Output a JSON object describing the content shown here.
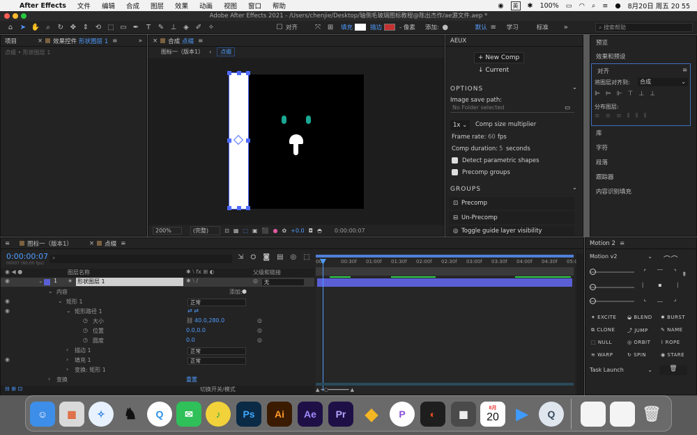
{
  "menubar": {
    "app": "After Effects",
    "items": [
      "文件",
      "编辑",
      "合成",
      "图层",
      "效果",
      "动画",
      "视图",
      "窗口",
      "帮助"
    ],
    "battery": "100%",
    "ime": "英",
    "datetime": "8月20日 周五 20 55"
  },
  "titlebar": {
    "title": "Adobe After Effects 2021 - /Users/chenjie/Desktop/轴侧毛玻璃图标教程@陈出杰作/ae源文件.aep *"
  },
  "toolbar": {
    "align_label": "对齐",
    "fill_label": "填充",
    "stroke_label": "描边",
    "px_label": "- 像素",
    "add_label": "添加:",
    "workspaces": [
      "默认",
      "学习",
      "标准"
    ],
    "search_placeholder": "搜索帮助"
  },
  "project_panel": {
    "tab1": "项目",
    "tab2": "效果控件",
    "tab2_hl": "形状图层 1",
    "sub": "点缀 • 形状图层 1"
  },
  "comp_panel": {
    "tab_label": "合成",
    "tab_hl": "点缀",
    "crumb1": "图标一（版本1）",
    "crumb2": "点缀",
    "zoom": "200%",
    "quality": "(完整)",
    "exposure": "+0.0",
    "timecode": "0:00:00:07"
  },
  "aeux": {
    "title": "AEUX",
    "new_comp": "New Comp",
    "current": "Current",
    "options_header": "OPTIONS",
    "image_save_path": "Image save path:",
    "no_folder": "No Folder selected",
    "multiplier": "1x",
    "multiplier_label": "Comp size multiplier",
    "frame_rate_label": "Frame rate:",
    "frame_rate": "60",
    "fps": "fps",
    "duration_label": "Comp duration:",
    "duration": "5",
    "seconds": "seconds",
    "detect_shapes": "Detect parametric shapes",
    "precomp_groups": "Precomp groups",
    "groups_header": "GROUPS",
    "precomp": "Precomp",
    "unprecomp": "Un-Precomp",
    "toggle_guide": "Toggle guide layer visibility"
  },
  "right_panels": {
    "preview": "预览",
    "effects_presets": "效果和预设",
    "align": "对齐",
    "align_to": "将图层对齐到:",
    "align_to_value": "合成",
    "distribute": "分布图层:",
    "library": "库",
    "character": "字符",
    "paragraph": "段落",
    "tracker": "跟踪器",
    "content_aware": "内容识别填充"
  },
  "timeline": {
    "tab1": "图标一（版本1）",
    "tab2": "点缀",
    "timecode": "0:00:00:07",
    "frames_info": "00007 (60.00 fps)",
    "col_layer_name": "图层名称",
    "col_parent": "父级和链接",
    "layer_num": "1",
    "layer_name": "形状图层 1",
    "parent_value": "无",
    "contents": "内容",
    "add": "添加:",
    "rect1": "矩形 1",
    "rect_path": "矩形路径 1",
    "size": "大小",
    "size_val": "40.0,280.0",
    "position": "位置",
    "position_val": "0.0,0.0",
    "roundness": "圆度",
    "roundness_val": "0.0",
    "stroke1": "描边 1",
    "fill1": "填充 1",
    "transform_rect": "变换: 矩形 1",
    "transform": "变换",
    "reset": "重置",
    "blend_normal": "正常",
    "toggle_modes": "切换开关/模式",
    "ruler": [
      "00f",
      "00:30f",
      "01:00f",
      "01:30f",
      "02:00f",
      "02:30f",
      "03:00f",
      "03:30f",
      "04:00f",
      "04:30f",
      "05:0"
    ]
  },
  "motion": {
    "title": "Motion 2",
    "version": "Motion v2",
    "buttons": [
      "EXCITE",
      "BLEND",
      "BURST",
      "CLONE",
      "JUMP",
      "NAME",
      "NULL",
      "ORBIT",
      "ROPE",
      "WARP",
      "SPIN",
      "STARE"
    ],
    "task": "Task Launch"
  },
  "dock": {
    "apps": [
      "Finder",
      "Launchpad",
      "Safari",
      "QQ",
      "Quick",
      "WeChat",
      "Music",
      "Ps",
      "Ai",
      "Ae",
      "Pr",
      "Sketch",
      "Plasticity",
      "Figma",
      "Calculator",
      "Calendar",
      "Video",
      "QuickTime",
      "Preview",
      "Finder2",
      "Trash"
    ],
    "cal_month": "8月",
    "cal_day": "20"
  },
  "colors": {
    "accent": "#4f9cff",
    "layer_bar": "#5a5fd6",
    "green_marker": "#2fd14b",
    "teal_eye": "#1aa893"
  }
}
